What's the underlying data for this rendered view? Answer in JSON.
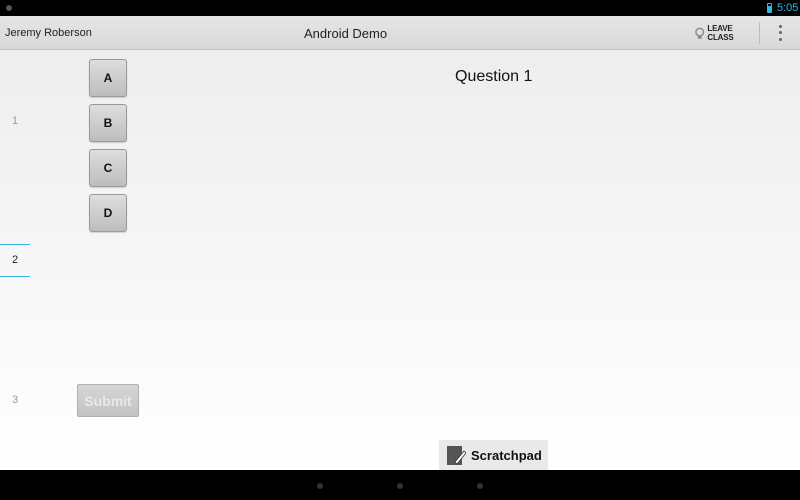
{
  "status_bar": {
    "time": "5:05"
  },
  "action_bar": {
    "user_name": "Jeremy Roberson",
    "title": "Android Demo",
    "leave_class_label": "LEAVE CLASS"
  },
  "question_nav": [
    {
      "label": "1",
      "active": false
    },
    {
      "label": "2",
      "active": true
    },
    {
      "label": "3",
      "active": false
    }
  ],
  "choices": [
    "A",
    "B",
    "C",
    "D"
  ],
  "submit_label": "Submit",
  "question_title": "Question 1",
  "scratchpad_label": "Scratchpad",
  "colors": {
    "accent": "#33b5e5"
  }
}
